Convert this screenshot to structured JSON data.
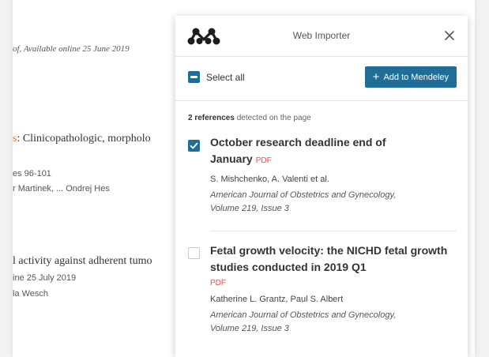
{
  "background": {
    "lines": [
      "of, Available online 25 June 2019",
      "s: Clinicopathologic, morpholo",
      "es 96-101",
      "r Martinek, ... Ondrej Hes",
      "l activity against adherent tumo",
      "ine 25 July 2019",
      "la Wesch"
    ]
  },
  "importer": {
    "title": "Web Importer",
    "select_all_label": "Select all",
    "add_button_label": "Add to Mendeley",
    "detected_count": "2 references",
    "detected_suffix": "detected on the page",
    "references": [
      {
        "checked": true,
        "title": "October research deadline end of January",
        "badge": "PDF",
        "authors": "S. Mishchenko, A. Valenti et al.",
        "journal": "American Journal of Obstetrics and Gynecology,",
        "volume": "Volume 219, Issue 3"
      },
      {
        "checked": false,
        "title": "Fetal growth velocity: the NICHD fetal growth studies conducted in 2019 Q1",
        "badge": "PDF",
        "authors": "Katherine L. Grantz, Paul S. Albert",
        "journal": "American Journal of Obstetrics and Gynecology,",
        "volume": "Volume 219, Issue 3"
      }
    ]
  },
  "colors": {
    "accent_blue": "#1f6e98",
    "pdf_red": "#e0504d",
    "title_highlight": "#e9711c"
  },
  "icons": {
    "logo": "mendeley-logo-icon",
    "close": "close-icon",
    "plus": "plus-icon",
    "check": "checkmark-icon"
  }
}
